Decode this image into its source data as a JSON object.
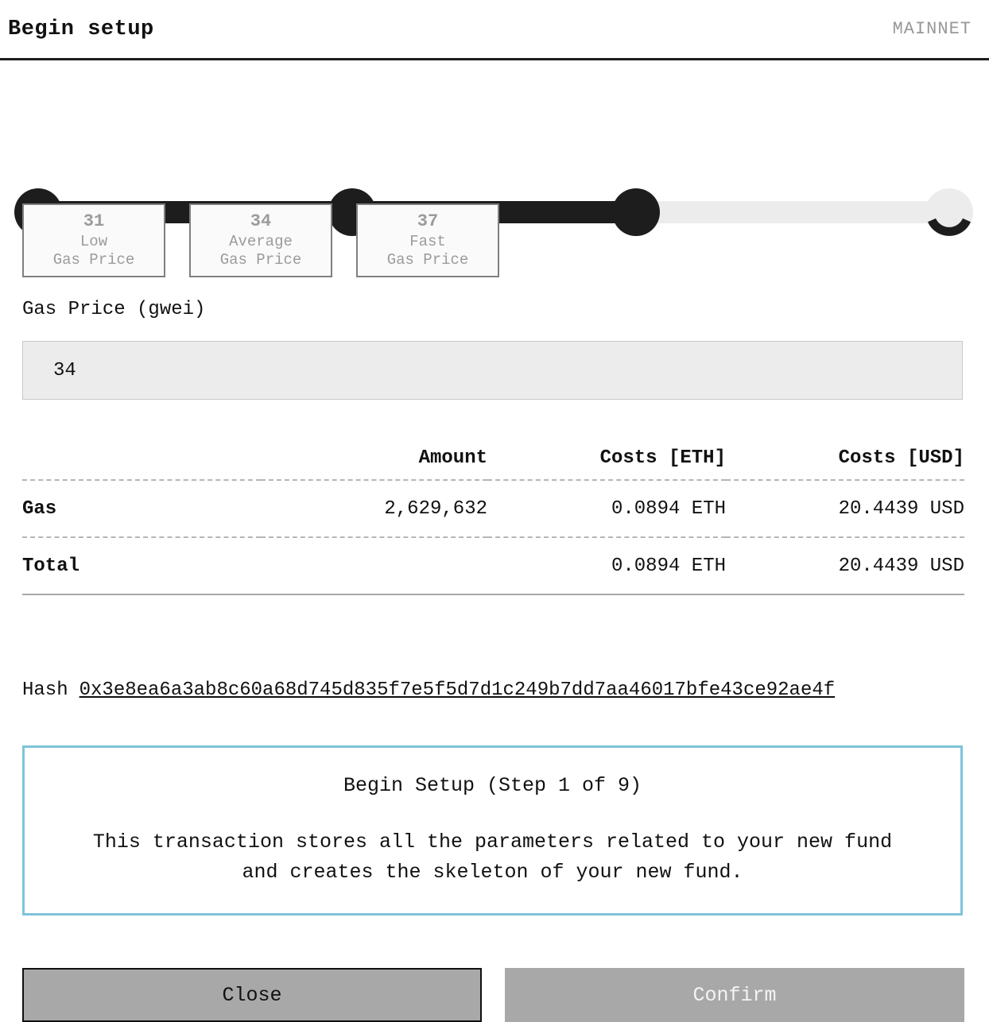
{
  "header": {
    "title": "Begin setup",
    "network": "MAINNET"
  },
  "stepper": {
    "total_nodes": 4,
    "completed_nodes": 3,
    "current_label": "loading-spinner",
    "fill_color": "#1d1d1d",
    "track_color": "#ececec"
  },
  "gas_presets": [
    {
      "value": "31",
      "label": "Low",
      "sublabel": "Gas Price"
    },
    {
      "value": "34",
      "label": "Average",
      "sublabel": "Gas Price"
    },
    {
      "value": "37",
      "label": "Fast",
      "sublabel": "Gas Price"
    }
  ],
  "gas_field": {
    "label": "Gas Price (gwei)",
    "value": "34",
    "placeholder": "Gas Price (gwei)"
  },
  "cost_table": {
    "headers": {
      "label": "",
      "amount": "Amount",
      "eth": "Costs [ETH]",
      "usd": "Costs [USD]"
    },
    "rows": [
      {
        "label": "Gas",
        "amount": "2,629,632",
        "eth": "0.0894 ETH",
        "usd": "20.4439 USD"
      },
      {
        "label": "Total",
        "amount": "",
        "eth": "0.0894 ETH",
        "usd": "20.4439 USD"
      }
    ]
  },
  "hash": {
    "label": "Hash",
    "value": "0x3e8ea6a3ab8c60a68d745d835f7e5f5d7d1c249b7dd7aa46017bfe43ce92ae4f"
  },
  "info_box": {
    "title": "Begin Setup (Step 1 of 9)",
    "body": "This transaction stores all the parameters related to your new fund and creates the skeleton of your new fund.",
    "border_color": "#7ec4da"
  },
  "footer": {
    "close_label": "Close",
    "confirm_label": "Confirm"
  }
}
